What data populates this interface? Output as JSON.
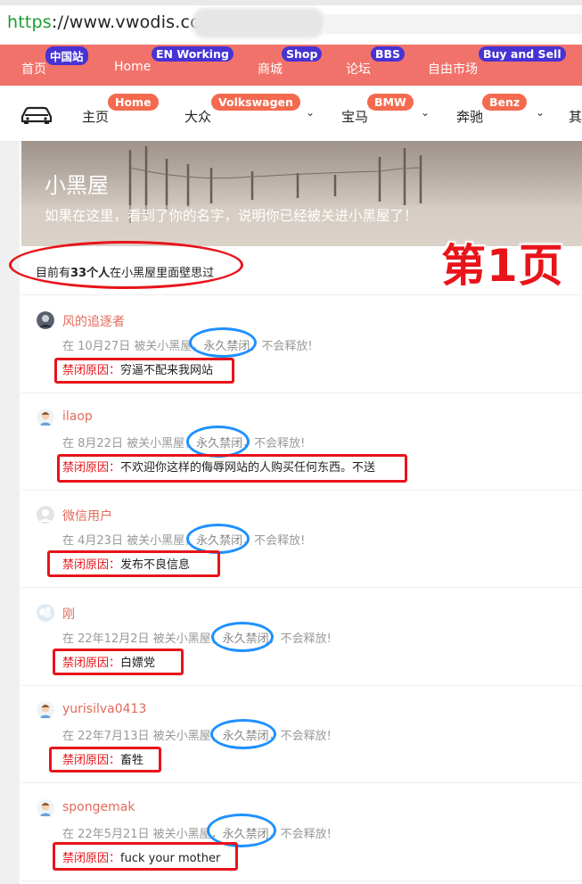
{
  "browser": {
    "url_protocol": "https",
    "url_host": "://www.vwodis.com/"
  },
  "topnav": [
    {
      "label": "首页",
      "badge": "中国站"
    },
    {
      "label": "Home",
      "badge": "EN Working"
    },
    {
      "label": "商城",
      "badge": "Shop"
    },
    {
      "label": "论坛",
      "badge": "BBS"
    },
    {
      "label": "自由市场",
      "badge": "Buy and Sell"
    }
  ],
  "subnav": [
    {
      "label": "主页",
      "badge": "Home"
    },
    {
      "label": "大众",
      "badge": "Volkswagen"
    },
    {
      "label": "宝马",
      "badge": "BMW"
    },
    {
      "label": "奔驰",
      "badge": "Benz"
    },
    {
      "label": "其"
    }
  ],
  "hero": {
    "title": "小黑屋",
    "subtitle": "如果在这里，看到了你的名字，说明你已经被关进小黑屋了！"
  },
  "count": {
    "prefix": "目前有",
    "number": "33个人",
    "suffix": "在小黑屋里面壁思过"
  },
  "page_mark": "第1页",
  "ban_reason_label": "禁闭原因：",
  "entries": [
    {
      "user": "风的追逐者",
      "when": "在 10月27日 被关小黑屋，",
      "perm": "永久禁闭",
      "tail": "，不会释放!",
      "reason": "穷逼不配来我网站"
    },
    {
      "user": "ilaop",
      "when": "在 8月22日 被关小黑屋，",
      "perm": "永久禁闭",
      "tail": "，不会释放!",
      "reason": "不欢迎你这样的侮辱网站的人购买任何东西。不送"
    },
    {
      "user": "微信用户",
      "when": "在 4月23日 被关小黑屋，",
      "perm": "永久禁闭",
      "tail": "，不会释放!",
      "reason": "发布不良信息"
    },
    {
      "user": "刚",
      "when": "在 22年12月2日 被关小黑屋，",
      "perm": "永久禁闭",
      "tail": "，不会释放!",
      "reason": "白嫖党"
    },
    {
      "user": "yurisilva0413",
      "when": "在 22年7月13日 被关小黑屋，",
      "perm": "永久禁闭",
      "tail": "，不会释放!",
      "reason": "畜牲"
    },
    {
      "user": "spongemak",
      "when": "在 22年5月21日 被关小黑屋，",
      "perm": "永久禁闭",
      "tail": "，不会释放!",
      "reason": "fuck your mother"
    }
  ],
  "colors": {
    "topnav_bg": "#f1726a",
    "badge_blue": "#4733d4",
    "badge_orange": "#f46a4f",
    "username": "#e26a5a",
    "annotation_red": "#e8141a",
    "annotation_blue": "#1e90ff"
  }
}
